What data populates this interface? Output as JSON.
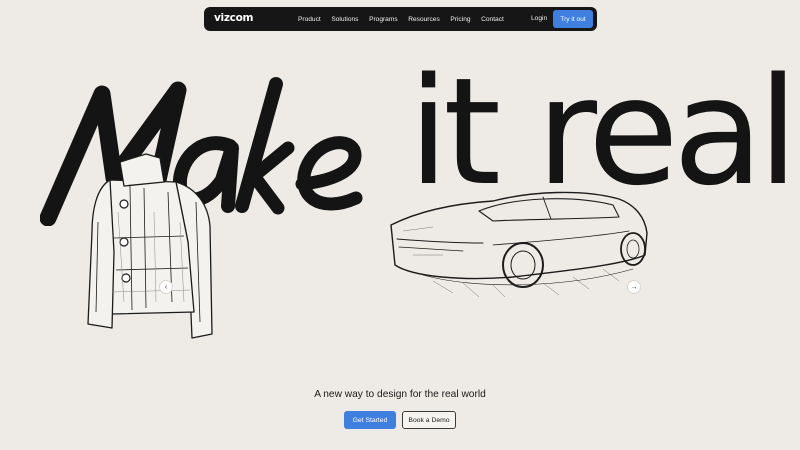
{
  "nav": {
    "logo": "vizcom",
    "menu": [
      "Product",
      "Solutions",
      "Programs",
      "Resources",
      "Pricing",
      "Contact"
    ],
    "login": "Login",
    "cta": "Try it out"
  },
  "hero": {
    "word_script": "Make",
    "words_right": "it real",
    "tagline": "A new way to design for the real world",
    "primary_button": "Get Started",
    "secondary_button": "Book a Demo"
  },
  "carousel": {
    "prev_icon": "chevron-left-icon",
    "next_icon": "arrow-right-icon"
  },
  "colors": {
    "background": "#eeebe6",
    "nav_bg": "#161616",
    "accent": "#3f7fe0",
    "ink": "#141414"
  }
}
